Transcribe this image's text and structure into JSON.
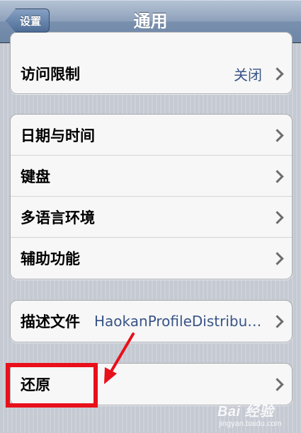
{
  "navbar": {
    "back_label": "设置",
    "title": "通用"
  },
  "group1": {
    "rows": [
      {
        "label": "访问限制",
        "value": "关闭"
      }
    ]
  },
  "group2": {
    "rows": [
      {
        "label": "日期与时间"
      },
      {
        "label": "键盘"
      },
      {
        "label": "多语言环境"
      },
      {
        "label": "辅助功能"
      }
    ]
  },
  "group3": {
    "rows": [
      {
        "label": "描述文件",
        "value": "HaokanProfileDistribu…"
      }
    ]
  },
  "group4": {
    "rows": [
      {
        "label": "还原"
      }
    ]
  },
  "annotation": {
    "highlight_color": "#e8101a"
  },
  "watermark": {
    "brand": "Bai 经验",
    "url": "jingyan.baidu.com"
  }
}
